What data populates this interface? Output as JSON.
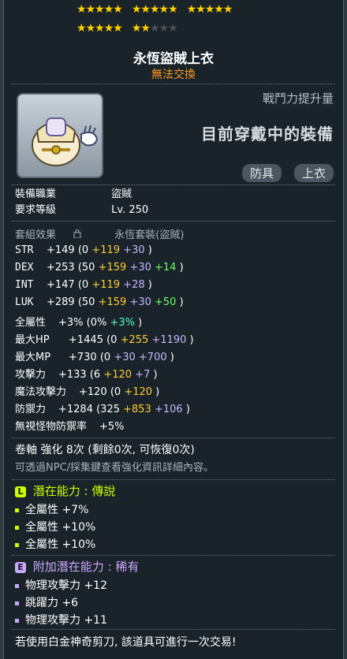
{
  "stars": {
    "total": 25,
    "filled": 22
  },
  "item": {
    "name": "永恆盜賊上衣",
    "trade_status": "無法交換",
    "power_up_label": "戰鬥力提升量",
    "equipped_label": "目前穿戴中的裝備",
    "tags": [
      "防具",
      "上衣"
    ]
  },
  "requirements": [
    {
      "label": "裝備職業",
      "value": "盜賊"
    },
    {
      "label": "要求等級",
      "value": "Lv. 250"
    }
  ],
  "set_effect": {
    "label": "套組效果",
    "value": "永恆套裝(盜賊)"
  },
  "stats": [
    {
      "name": "STR",
      "total": "+149",
      "base": "0",
      "parts": [
        {
          "v": "+119",
          "c": "yel"
        },
        {
          "v": "+30",
          "c": "purp"
        }
      ]
    },
    {
      "name": "DEX",
      "total": "+253",
      "base": "50",
      "parts": [
        {
          "v": "+159",
          "c": "yel"
        },
        {
          "v": "+30",
          "c": "purp"
        },
        {
          "v": "+14",
          "c": "grn"
        }
      ]
    },
    {
      "name": "INT",
      "total": "+147",
      "base": "0",
      "parts": [
        {
          "v": "+119",
          "c": "yel"
        },
        {
          "v": "+28",
          "c": "purp"
        }
      ]
    },
    {
      "name": "LUK",
      "total": "+289",
      "base": "50",
      "parts": [
        {
          "v": "+159",
          "c": "yel"
        },
        {
          "v": "+30",
          "c": "purp"
        },
        {
          "v": "+50",
          "c": "grn"
        }
      ]
    },
    {
      "name": "全屬性",
      "total": "+3%",
      "base": "0%",
      "parts": [
        {
          "v": "+3%",
          "c": "cyn"
        }
      ]
    },
    {
      "name": "最大HP",
      "total": "+1445",
      "base": "0",
      "parts": [
        {
          "v": "+255",
          "c": "yel"
        },
        {
          "v": "+1190",
          "c": "purp"
        }
      ]
    },
    {
      "name": "最大MP",
      "total": "+730",
      "base": "0",
      "parts": [
        {
          "v": "+30",
          "c": "purp"
        },
        {
          "v": "+700",
          "c": "purp"
        }
      ]
    },
    {
      "name": "攻擊力",
      "total": "+133",
      "base": "6",
      "parts": [
        {
          "v": "+120",
          "c": "yel"
        },
        {
          "v": "+7",
          "c": "purp"
        }
      ]
    },
    {
      "name": "魔法攻擊力",
      "total": "+120",
      "base": "0",
      "parts": [
        {
          "v": "+120",
          "c": "yel"
        }
      ]
    },
    {
      "name": "防禦力",
      "total": "+1284",
      "base": "325",
      "parts": [
        {
          "v": "+853",
          "c": "yel"
        },
        {
          "v": "+106",
          "c": "purp"
        }
      ]
    },
    {
      "name": "無視怪物防禦率",
      "total": "+5%",
      "base": null,
      "parts": []
    }
  ],
  "scroll": {
    "text": "卷軸 強化 8次 (剩餘0次, 可恢復0次)"
  },
  "enhance_hint": "可透過NPC/採集鍵查看強化資訊詳細內容。",
  "potential": {
    "label": "潛在能力 : 傳說",
    "badge": "L",
    "color": "#ccff00",
    "lines": [
      "全屬性 +7%",
      "全屬性 +10%",
      "全屬性 +10%"
    ]
  },
  "bonus_potential": {
    "label": "附加潛在能力 : 稀有",
    "badge": "E",
    "color": "#c9a8ff",
    "lines": [
      "物理攻擊力 +12",
      "跳躍力 +6",
      "物理攻擊力 +11"
    ]
  },
  "footer": "若使用白金神奇剪刀, 該道具可進行一次交易!"
}
